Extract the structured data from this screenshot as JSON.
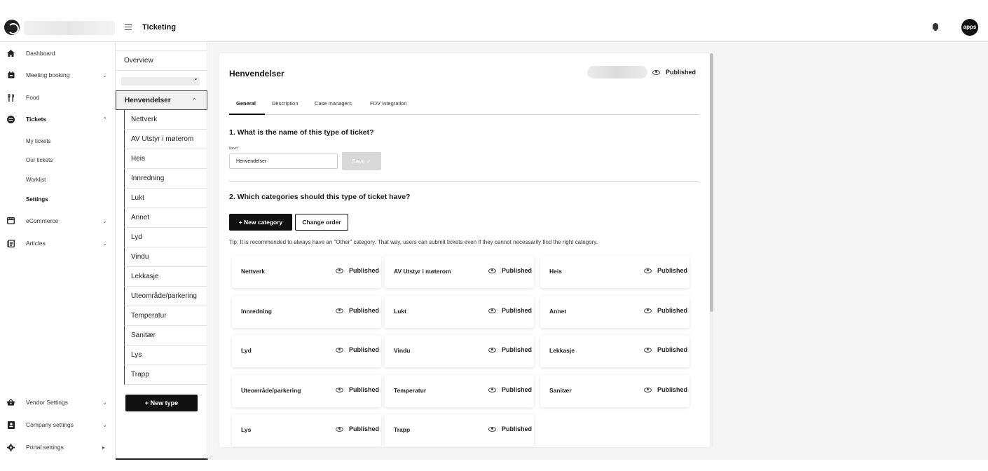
{
  "topbar": {
    "title": "Ticketing",
    "avatar_text": "apps"
  },
  "sidebar": {
    "items": [
      {
        "label": "Dashboard",
        "icon": "home-icon",
        "chevron": ""
      },
      {
        "label": "Meeting booking",
        "icon": "calendar-icon",
        "chevron": "⌄"
      },
      {
        "label": "Food",
        "icon": "cutlery-icon",
        "chevron": ""
      },
      {
        "label": "Tickets",
        "icon": "chat-bubble-icon",
        "chevron": "⌃"
      },
      {
        "label": "eCommerce",
        "icon": "store-icon",
        "chevron": "⌄"
      },
      {
        "label": "Articles",
        "icon": "article-icon",
        "chevron": "⌄"
      }
    ],
    "ticket_sub": [
      "My tickets",
      "Our tickets",
      "Worklist",
      "Settings"
    ],
    "bottom": [
      {
        "label": "Vendor Settings",
        "icon": "basket-icon",
        "chevron": "⌄"
      },
      {
        "label": "Company settings",
        "icon": "badge-icon",
        "chevron": "⌄"
      },
      {
        "label": "Portal settings",
        "icon": "gear-icon",
        "chevron": "▸"
      }
    ]
  },
  "types_column": {
    "overview": "Overview",
    "group": "Henvendelser",
    "children": [
      "Nettverk",
      "AV Utstyr i møterom",
      "Heis",
      "Innredning",
      "Lukt",
      "Annet",
      "Lyd",
      "Vindu",
      "Lekkasje",
      "Uteområde/parkering",
      "Temperatur",
      "Sanitær",
      "Lys",
      "Trapp"
    ],
    "new_type": "+ New type"
  },
  "main": {
    "title": "Henvendelser",
    "status": "Published",
    "tabs": [
      "General",
      "Description",
      "Case managers",
      "FDV Integration"
    ],
    "section1": "1. What is the name of this type of ticket?",
    "field_label": "Navn*",
    "field_value": "Henvendelser",
    "save": "Save ✓",
    "section2": "2. Which categories should this type of ticket have?",
    "new_category": "+ New category",
    "change_order": "Change order",
    "tip": "Tip: It is recommended to always have an \"Other\" category. That way, users can submit tickets even if they cannot necessarily find the right category.",
    "categories": [
      {
        "name": "Nettverk",
        "status": "Published"
      },
      {
        "name": "AV Utstyr i møterom",
        "status": "Published"
      },
      {
        "name": "Heis",
        "status": "Published"
      },
      {
        "name": "Innredning",
        "status": "Published"
      },
      {
        "name": "Lukt",
        "status": "Published"
      },
      {
        "name": "Annet",
        "status": "Published"
      },
      {
        "name": "Lyd",
        "status": "Published"
      },
      {
        "name": "Vindu",
        "status": "Published"
      },
      {
        "name": "Lekkasje",
        "status": "Published"
      },
      {
        "name": "Uteområde/parkering",
        "status": "Published"
      },
      {
        "name": "Temperatur",
        "status": "Published"
      },
      {
        "name": "Sanitær",
        "status": "Published"
      },
      {
        "name": "Lys",
        "status": "Published"
      },
      {
        "name": "Trapp",
        "status": "Published"
      }
    ]
  }
}
